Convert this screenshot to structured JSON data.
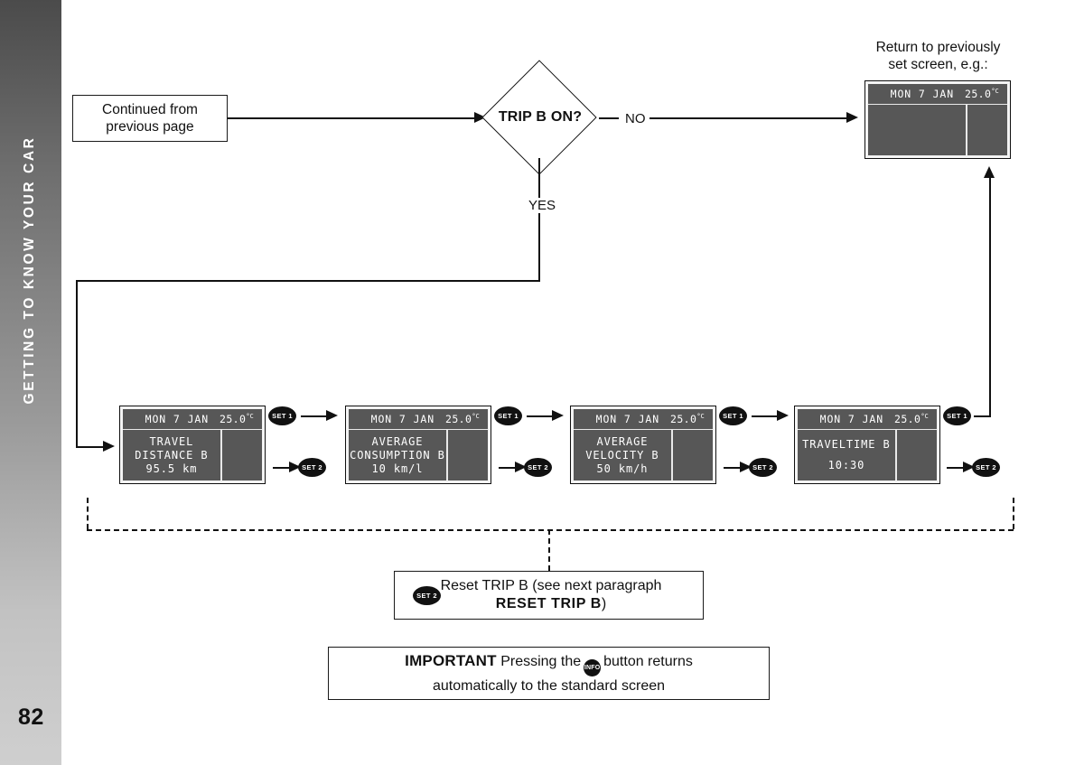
{
  "sidebar": {
    "chapter_title": "GETTING TO KNOW YOUR CAR",
    "page_number": "82"
  },
  "flow": {
    "continued_box": "Continued from\nprevious page",
    "decision": "TRIP B ON?",
    "branch_no": "NO",
    "branch_yes": "YES",
    "return_caption": "Return to previously\nset screen, e.g.:"
  },
  "display_common": {
    "date": "MON 7 JAN",
    "temperature": "25.0",
    "temperature_unit": "°C"
  },
  "displays": [
    {
      "name": "return-screen",
      "date": "MON 7 JAN",
      "temperature": "25.0",
      "temperature_unit": "°C",
      "lines": []
    },
    {
      "name": "travel-distance-b",
      "date": "MON 7 JAN",
      "temperature": "25.0",
      "temperature_unit": "°C",
      "lines": [
        "TRAVEL",
        "DISTANCE B",
        "95.5 km"
      ]
    },
    {
      "name": "average-consumption-b",
      "date": "MON 7 JAN",
      "temperature": "25.0",
      "temperature_unit": "°C",
      "lines": [
        "AVERAGE",
        "CONSUMPTION B",
        "10 km/l"
      ]
    },
    {
      "name": "average-velocity-b",
      "date": "MON 7 JAN",
      "temperature": "25.0",
      "temperature_unit": "°C",
      "lines": [
        "AVERAGE",
        "VELOCITY B",
        "50 km/h"
      ]
    },
    {
      "name": "traveltime-b",
      "date": "MON 7 JAN",
      "temperature": "25.0",
      "temperature_unit": "°C",
      "lines": [
        "TRAVELTIME B",
        "",
        "10:30"
      ]
    }
  ],
  "buttons": {
    "set1": "SET 1",
    "set2": "SET 2",
    "info": "INFO"
  },
  "reset_note": {
    "button": "SET 2",
    "line1": "Reset TRIP B (see next paragraph",
    "line2_bold": "RESET TRIP B",
    "line2_tail": ")"
  },
  "important_note": {
    "label": "IMPORTANT",
    "text_before": "Pressing the",
    "button": "INFO",
    "text_after": "button returns",
    "line2": "automatically to the standard screen"
  },
  "colors": {
    "ink": "#111111",
    "lcd_screen": "#575757",
    "lcd_text": "#ffffff",
    "sidebar_top": "#4b4b4b",
    "sidebar_bottom": "#cfcfcf"
  }
}
